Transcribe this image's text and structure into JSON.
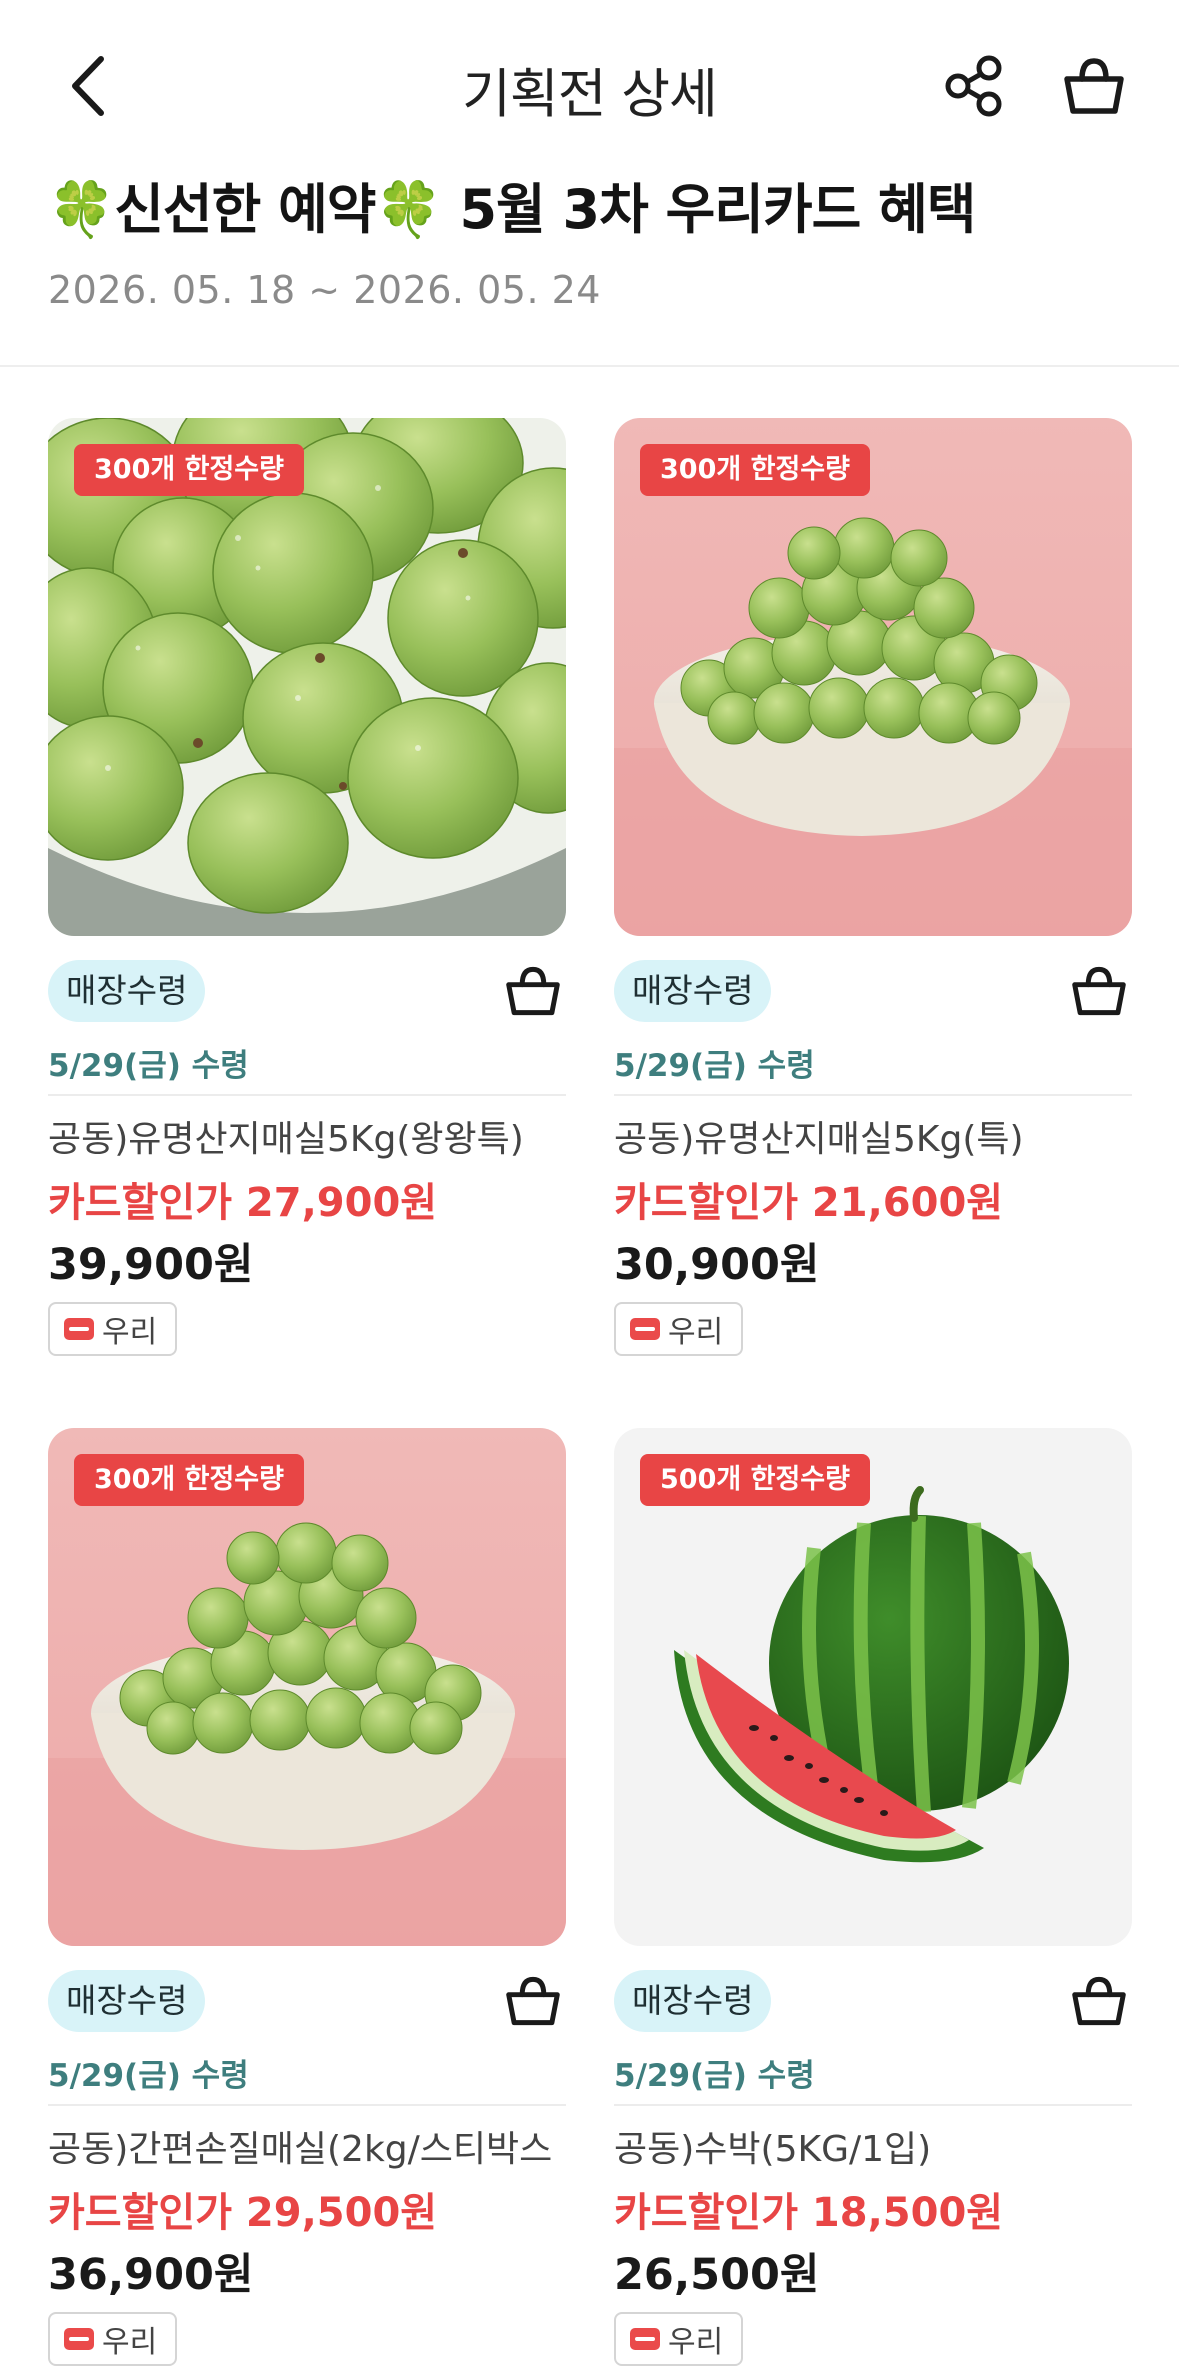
{
  "header": {
    "title": "기획전 상세"
  },
  "event": {
    "title": "🍀신선한 예약🍀 5월 3차 우리카드 혜택",
    "period": "2026. 05. 18 ~ 2026. 05. 24"
  },
  "icons": {
    "back": "chevron-left-icon",
    "share": "share-icon",
    "cart": "basket-icon",
    "card": "credit-card-icon"
  },
  "colors": {
    "accent_red": "#e84545",
    "pickup_chip_bg": "#d8f3f8",
    "pickup_date": "#3e7e7e"
  },
  "products": [
    {
      "limit_badge": "300개 한정수량",
      "pickup_label": "매장수령",
      "pickup_date": "5/29(금) 수령",
      "name": "공동)유명산지매실5Kg(왕왕특)",
      "card_price": "카드할인가 27,900원",
      "price": "39,900원",
      "bank": "우리",
      "image": "green-plums-closeup"
    },
    {
      "limit_badge": "300개 한정수량",
      "pickup_label": "매장수령",
      "pickup_date": "5/29(금) 수령",
      "name": "공동)유명산지매실5Kg(특)",
      "card_price": "카드할인가 21,600원",
      "price": "30,900원",
      "bank": "우리",
      "image": "green-plums-bowl-pink"
    },
    {
      "limit_badge": "300개 한정수량",
      "pickup_label": "매장수령",
      "pickup_date": "5/29(금) 수령",
      "name": "공동)간편손질매실(2kg/스티박스",
      "card_price": "카드할인가 29,500원",
      "price": "36,900원",
      "bank": "우리",
      "image": "green-plums-bowl-pink"
    },
    {
      "limit_badge": "500개 한정수량",
      "pickup_label": "매장수령",
      "pickup_date": "5/29(금) 수령",
      "name": "공동)수박(5KG/1입)",
      "card_price": "카드할인가 18,500원",
      "price": "26,500원",
      "bank": "우리",
      "image": "watermelon"
    }
  ]
}
